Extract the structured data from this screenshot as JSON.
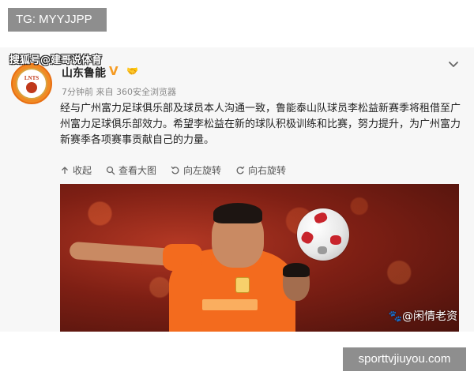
{
  "tg_label": "TG: MYYJJPP",
  "post": {
    "source_tag": "搜狐号@建哥说体育",
    "avatar_text": "LNTS",
    "username": "山东鲁能",
    "verify_icon": "verified-v-icon",
    "sticker_icon": "emoji-sticker-icon",
    "meta": "7分钟前 来自 360安全浏览器",
    "content": "经与广州富力足球俱乐部及球员本人沟通一致，鲁能泰山队球员李松益新赛季将租借至广州富力足球俱乐部效力。希望李松益在新的球队积极训练和比赛，努力提升，为广州富力新赛季各项赛事贡献自己的力量。",
    "actions": {
      "collapse": "收起",
      "view_large": "查看大图",
      "rotate_left": "向左旋转",
      "rotate_right": "向右旋转"
    },
    "photo_watermark": "🐾@闲情老资"
  },
  "site_label": "sporttvjiuyou.com",
  "colors": {
    "badge_bg": "#8e8e8e",
    "card_bg": "#f7f7f7",
    "verify": "#f59b23",
    "jersey": "#f36b1e"
  }
}
